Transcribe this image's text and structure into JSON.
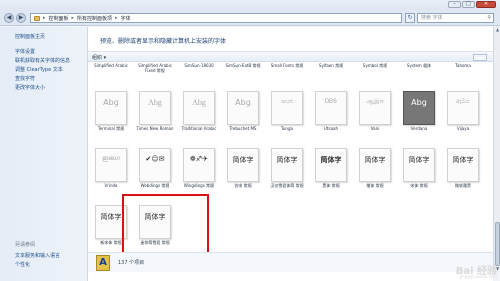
{
  "window": {
    "minimize": "–",
    "maximize": "□",
    "close": "✕"
  },
  "address": {
    "back_icon": "back-arrow-icon",
    "crumbs": [
      "控制面板",
      "所有控制面板项",
      "字体"
    ],
    "search_placeholder": "搜索 字体"
  },
  "sidebar": {
    "home": "控制面板主页",
    "links": [
      "字体设置",
      "联机获取有关字体的信息",
      "调整 ClearType 文本",
      "查找字符",
      "更改字体大小"
    ],
    "see_also_title": "另请参阅",
    "see_also": [
      "文本服务和输入语言",
      "个性化"
    ]
  },
  "header": {
    "title": "预览、删除或者显示和隐藏计算机上安装的字体"
  },
  "toolbar": {
    "organize": "组织 ▾"
  },
  "fonts": {
    "row0": [
      "Simplified Arabic",
      "Simplified Arabic Fixed 常规",
      "SimSun-18030",
      "SimSun-ExtB 常规",
      "Small Fonts 常规",
      "Sylfaen 常规",
      "Symbol 常规",
      "System 粗体",
      "Tahoma"
    ],
    "row1": [
      {
        "sample": "Abg",
        "label": "Terminal 常规"
      },
      {
        "sample": "Abg",
        "label": "Times New Roman"
      },
      {
        "sample": "Abg",
        "label": "Traditional Arabic"
      },
      {
        "sample": "Abg",
        "label": "Trebuchet MS"
      },
      {
        "sample": "ಅಬಗ",
        "label": "Tunga"
      },
      {
        "sample": "ᎠᏴᎦ",
        "label": "Utsaah"
      },
      {
        "sample": "ஆஇஈ",
        "label": "Vani"
      },
      {
        "sample": "Abg",
        "label": "Verdana"
      },
      {
        "sample": "ඇබග",
        "label": "Vijaya"
      }
    ],
    "row2": [
      {
        "sample": "ഇഌഗ",
        "label": "Vrinda"
      },
      {
        "sample": "✔☺✉",
        "label": "Webdings 常规"
      },
      {
        "sample": "❁♐✈",
        "label": "Wingdings 常规"
      },
      {
        "sample": "简体字",
        "label": "仿宋 常规"
      },
      {
        "sample": "简体字",
        "label": "汉仪雪君体简 常规"
      },
      {
        "sample": "简体字",
        "label": "黑体 常规"
      },
      {
        "sample": "简体字",
        "label": "楷体 常规"
      },
      {
        "sample": "简体字",
        "label": "宋体 常规"
      },
      {
        "sample": "简体字",
        "label": "微软雅黑"
      }
    ],
    "row3": [
      {
        "sample": "简体字",
        "label": "新宋体 常规"
      },
      {
        "sample": "简体字",
        "label": "迷你简雪君 常规"
      }
    ]
  },
  "status": {
    "count": "137 个项目"
  },
  "watermark": {
    "brand": "Bai 经验",
    "url": "jingyan.baidu.com"
  },
  "colors": {
    "highlight": "#dd1111",
    "link": "#1f4f8b"
  }
}
